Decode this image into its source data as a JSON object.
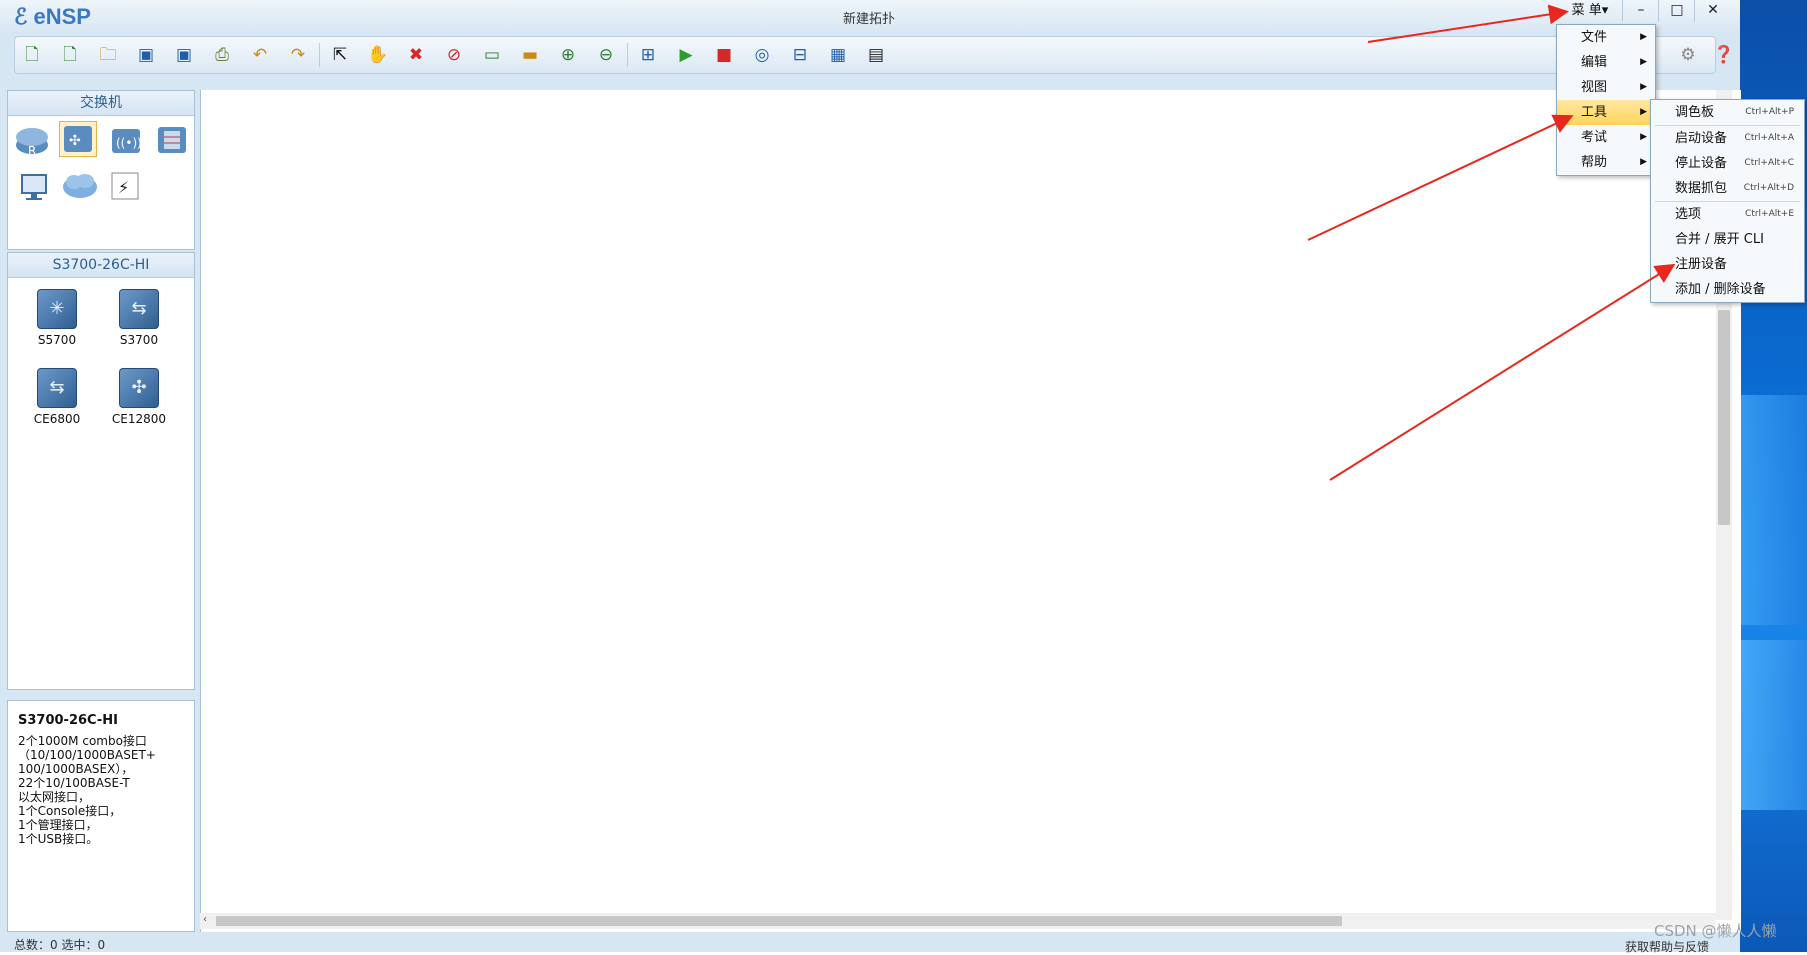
{
  "window": {
    "app_name": "eNSP",
    "title": "新建拓扑",
    "menu_label": "菜 单",
    "controls": [
      "–",
      "□",
      "✕"
    ]
  },
  "toolbar": {
    "icons": [
      "new-topology",
      "new-lab",
      "open",
      "save",
      "save-as",
      "print",
      "undo",
      "redo",
      "select",
      "hand",
      "delete",
      "delete-link",
      "text",
      "rectangle",
      "zoom-in",
      "zoom-reset",
      "topology",
      "start",
      "stop",
      "capture",
      "layout",
      "grid",
      "cli",
      "settings",
      "help"
    ]
  },
  "left_panel": {
    "category_title": "交换机",
    "category_icons": [
      "router-icon",
      "switch-icon",
      "wireless-icon",
      "firewall-icon",
      "pc-icon",
      "cloud-icon",
      "link-icon"
    ],
    "model_title": "S3700-26C-HI",
    "devices": [
      {
        "label": "S5700",
        "icon": "✳"
      },
      {
        "label": "S3700",
        "icon": "⇆"
      },
      {
        "label": "CE6800",
        "icon": "⇆"
      },
      {
        "label": "CE12800",
        "icon": "✣"
      }
    ],
    "description_title": "S3700-26C-HI",
    "description_text": "2个1000M combo接口\n（10/100/1000BASET+\n100/1000BASEX），\n22个10/100BASE-T\n以太网接口，\n1个Console接口，\n1个管理接口，\n1个USB接口。"
  },
  "status_bar": {
    "left": "总数：0  选中：0",
    "right": "获取帮助与反馈"
  },
  "main_menu": {
    "items": [
      {
        "label": "文件",
        "submenu": true
      },
      {
        "label": "编辑",
        "submenu": true
      },
      {
        "label": "视图",
        "submenu": true
      },
      {
        "label": "工具",
        "submenu": true,
        "active": true
      },
      {
        "label": "考试",
        "submenu": true
      },
      {
        "label": "帮助",
        "submenu": true
      }
    ]
  },
  "tools_menu": {
    "items": [
      {
        "label": "调色板",
        "shortcut": "Ctrl+Alt+P"
      },
      {
        "label": "启动设备",
        "shortcut": "Ctrl+Alt+A"
      },
      {
        "label": "停止设备",
        "shortcut": "Ctrl+Alt+C"
      },
      {
        "label": "数据抓包",
        "shortcut": "Ctrl+Alt+D"
      },
      {
        "label": "选项",
        "shortcut": "Ctrl+Alt+E"
      },
      {
        "label": "合并 / 展开 CLI",
        "shortcut": ""
      },
      {
        "label": "注册设备",
        "shortcut": ""
      },
      {
        "label": "添加 / 删除设备",
        "shortcut": ""
      }
    ]
  },
  "watermark": "CSDN @懒人人懒",
  "colors": {
    "arrow": "#e8281e",
    "highlight": "#ffd45a",
    "app_bg": "#d7e6f3"
  }
}
